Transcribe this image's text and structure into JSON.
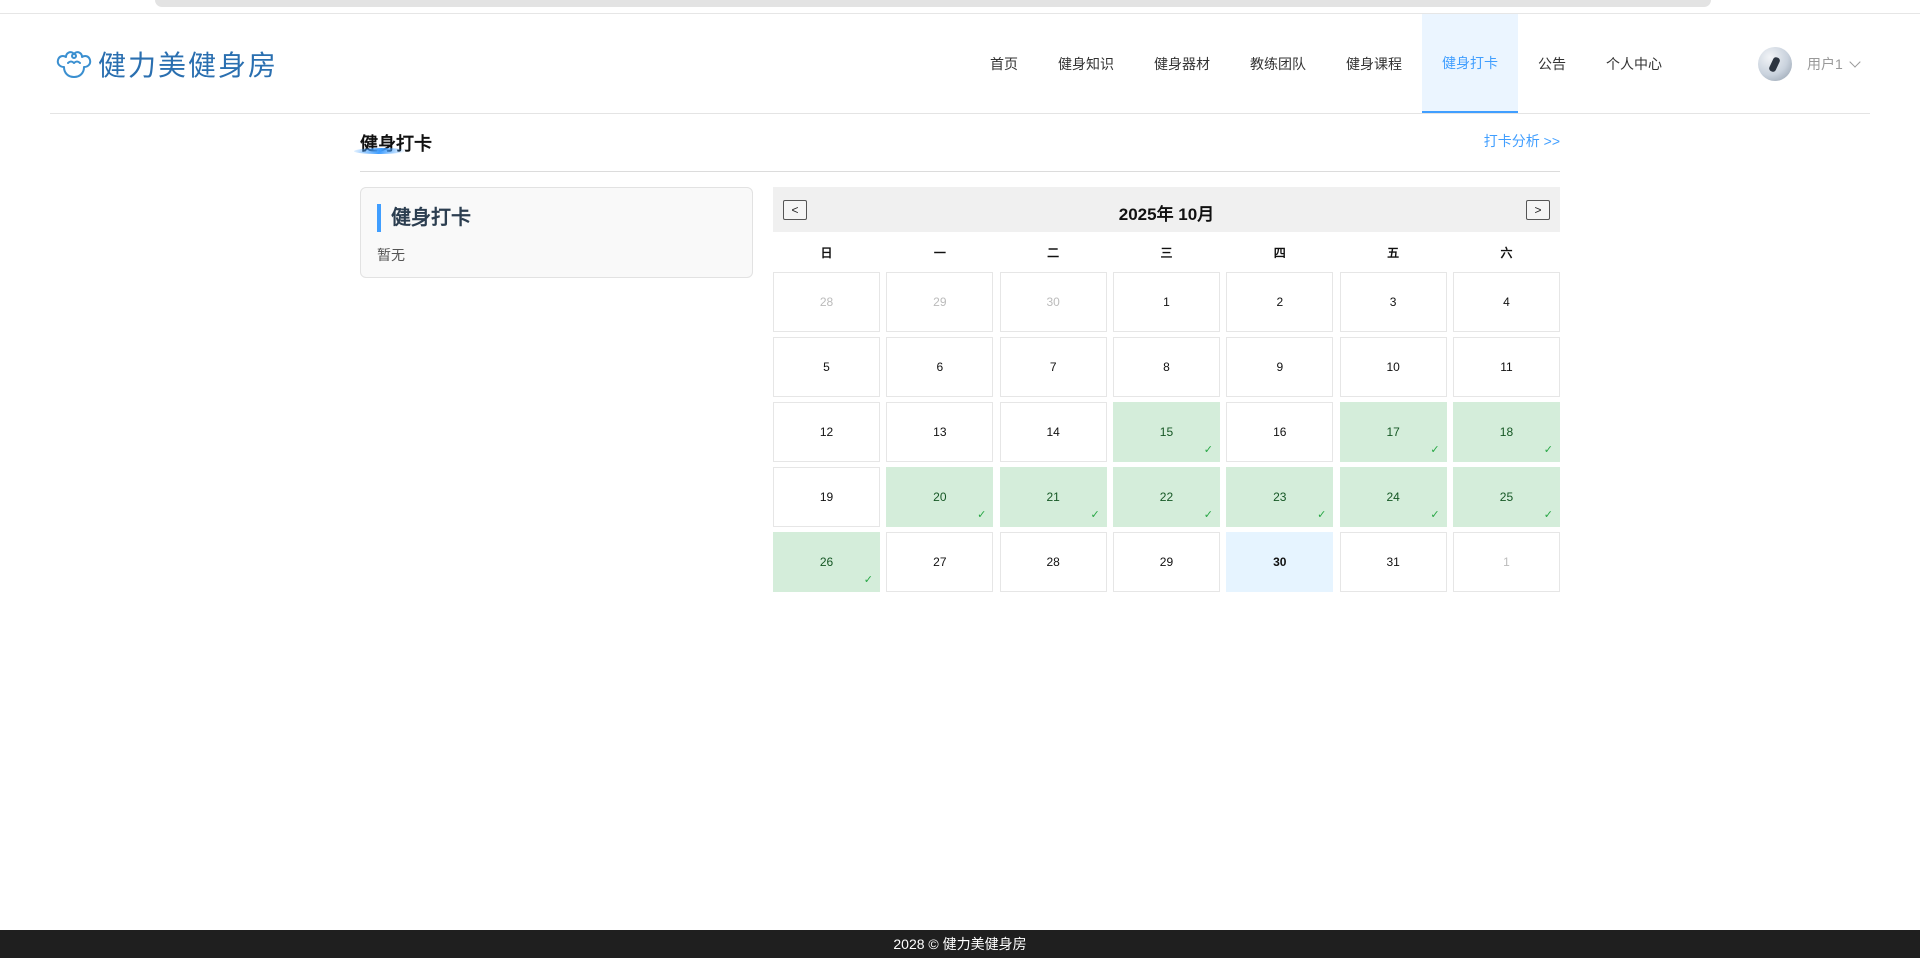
{
  "brand": {
    "name": "健力美健身房"
  },
  "nav": [
    {
      "label": "首页",
      "active": false
    },
    {
      "label": "健身知识",
      "active": false
    },
    {
      "label": "健身器材",
      "active": false
    },
    {
      "label": "教练团队",
      "active": false
    },
    {
      "label": "健身课程",
      "active": false
    },
    {
      "label": "健身打卡",
      "active": true
    },
    {
      "label": "公告",
      "active": false
    },
    {
      "label": "个人中心",
      "active": false
    }
  ],
  "user": {
    "name": "用户1"
  },
  "section": {
    "title": "健身打卡",
    "link": "打卡分析 >>"
  },
  "card": {
    "title": "健身打卡",
    "text": "暂无"
  },
  "calendar": {
    "title": "2025年 10月",
    "prev": "<",
    "next": ">",
    "check_mark": "✓",
    "weekdays": [
      "日",
      "一",
      "二",
      "三",
      "四",
      "五",
      "六"
    ],
    "days": [
      {
        "d": "28",
        "other": true
      },
      {
        "d": "29",
        "other": true
      },
      {
        "d": "30",
        "other": true
      },
      {
        "d": "1"
      },
      {
        "d": "2"
      },
      {
        "d": "3"
      },
      {
        "d": "4"
      },
      {
        "d": "5"
      },
      {
        "d": "6"
      },
      {
        "d": "7"
      },
      {
        "d": "8"
      },
      {
        "d": "9"
      },
      {
        "d": "10"
      },
      {
        "d": "11"
      },
      {
        "d": "12"
      },
      {
        "d": "13"
      },
      {
        "d": "14"
      },
      {
        "d": "15",
        "checked": true
      },
      {
        "d": "16"
      },
      {
        "d": "17",
        "checked": true
      },
      {
        "d": "18",
        "checked": true
      },
      {
        "d": "19"
      },
      {
        "d": "20",
        "checked": true
      },
      {
        "d": "21",
        "checked": true
      },
      {
        "d": "22",
        "checked": true
      },
      {
        "d": "23",
        "checked": true
      },
      {
        "d": "24",
        "checked": true
      },
      {
        "d": "25",
        "checked": true
      },
      {
        "d": "26",
        "checked": true
      },
      {
        "d": "27"
      },
      {
        "d": "28"
      },
      {
        "d": "29"
      },
      {
        "d": "30",
        "today": true
      },
      {
        "d": "31"
      },
      {
        "d": "1",
        "other": true
      }
    ]
  },
  "footer": {
    "text": "2028 © 健力美健身房"
  },
  "colors": {
    "accent": "#409eff",
    "checked_bg": "#d4edda",
    "today_bg": "#e6f4ff",
    "footer_bg": "#1f1f1f"
  }
}
